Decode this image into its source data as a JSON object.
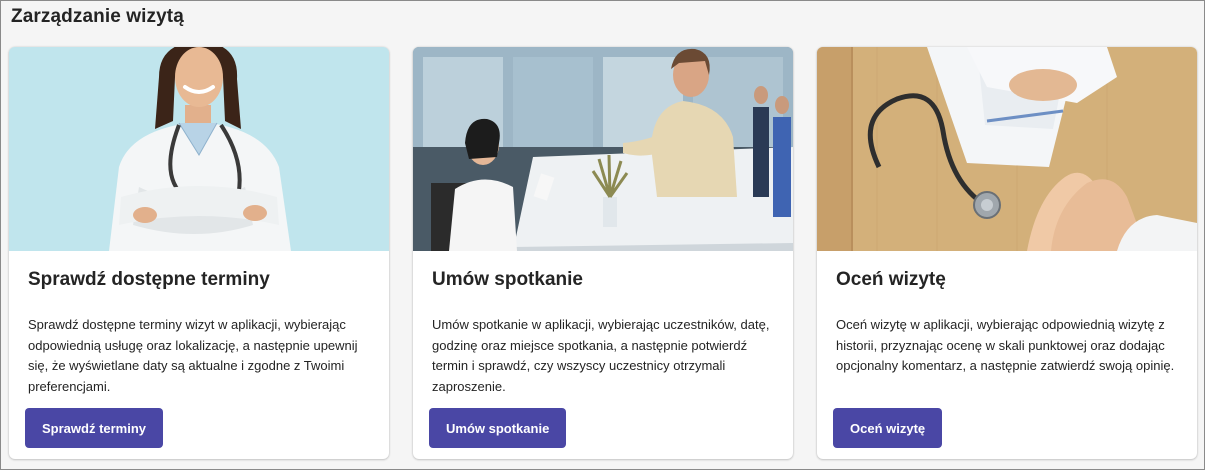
{
  "section": {
    "title": "Zarządzanie wizytą"
  },
  "cards": [
    {
      "title": "Sprawdź dostępne terminy",
      "description": "Sprawdź dostępne terminy wizyt w aplikacji, wybierając odpowiednią usługę oraz lokalizację, a następnie upewnij się, że wyświetlane daty są aktualne i zgodne z Twoimi preferencjami.",
      "button_label": "Sprawdź terminy"
    },
    {
      "title": "Umów spotkanie",
      "description": "Umów spotkanie w aplikacji, wybierając uczestników, datę, godzinę oraz miejsce spotkania, a następnie potwierdź termin i sprawdź, czy wszyscy uczestnicy otrzymali zaproszenie.",
      "button_label": "Umów spotkanie"
    },
    {
      "title": "Oceń wizytę",
      "description": "Oceń wizytę w aplikacji, wybierając odpowiednią wizytę z historii, przyznając ocenę w skali punktowej oraz dodając opcjonalny komentarz, a następnie zatwierdź swoją opinię.",
      "button_label": "Oceń wizytę"
    }
  ],
  "colors": {
    "button_bg": "#4a47a5",
    "background": "#f5f5f5",
    "card_bg": "#ffffff",
    "text": "#242424"
  }
}
